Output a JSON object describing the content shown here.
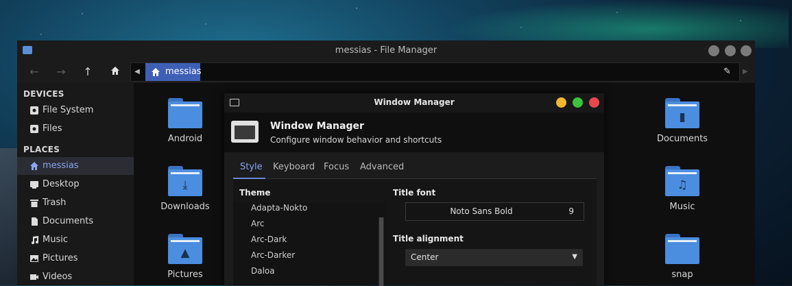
{
  "file_manager": {
    "title": "messias - File Manager",
    "path": "messias",
    "sidebar": {
      "devices_heading": "DEVICES",
      "devices": [
        {
          "label": "File System",
          "icon": "drive-icon"
        },
        {
          "label": "Files",
          "icon": "drive-icon"
        }
      ],
      "places_heading": "PLACES",
      "places": [
        {
          "label": "messias",
          "icon": "home-icon",
          "active": true
        },
        {
          "label": "Desktop",
          "icon": "desktop-icon"
        },
        {
          "label": "Trash",
          "icon": "trash-icon"
        },
        {
          "label": "Documents",
          "icon": "document-icon"
        },
        {
          "label": "Music",
          "icon": "music-icon"
        },
        {
          "label": "Pictures",
          "icon": "picture-icon"
        },
        {
          "label": "Videos",
          "icon": "video-icon"
        }
      ]
    },
    "files": {
      "android": "Android",
      "downloads": "Downloads",
      "pictures": "Pictures",
      "documents": "Documents",
      "music": "Music",
      "snap": "snap"
    },
    "colors": {
      "accent": "#3f5fb5",
      "folder": "#4b8ee0"
    }
  },
  "window_manager": {
    "title": "Window Manager",
    "header_title": "Window Manager",
    "header_subtitle": "Configure window behavior and shortcuts",
    "tabs": [
      "Style",
      "Keyboard",
      "Focus",
      "Advanced"
    ],
    "active_tab": "Style",
    "theme_label": "Theme",
    "themes": [
      "Adapta-Nokto",
      "Arc",
      "Arc-Dark",
      "Arc-Darker",
      "Daloa"
    ],
    "title_font_label": "Title font",
    "title_font_name": "Noto Sans Bold",
    "title_font_size": "9",
    "title_alignment_label": "Title alignment",
    "title_alignment_value": "Center",
    "colors": {
      "close": "#e5484d",
      "maximize": "#3cc23c",
      "minimize": "#f0b72f"
    }
  }
}
